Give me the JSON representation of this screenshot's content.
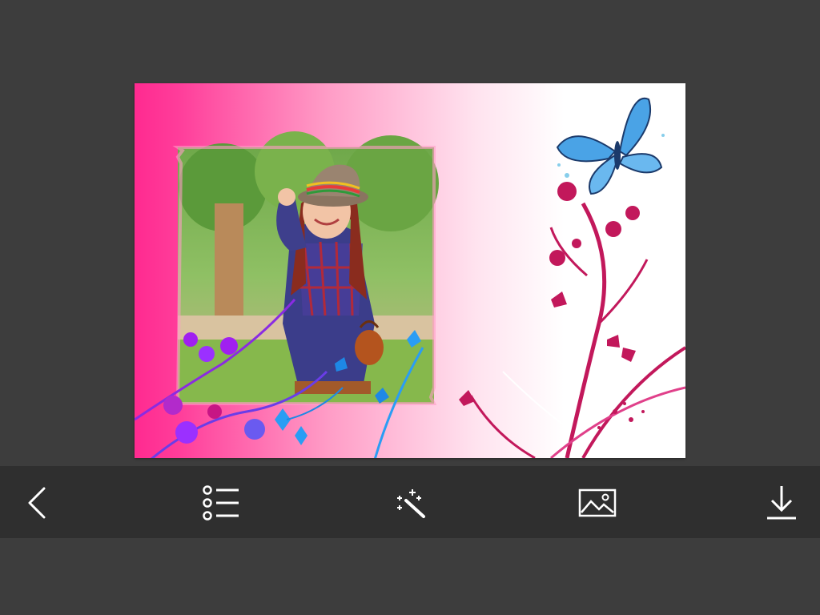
{
  "colors": {
    "background": "#3d3d3d",
    "toolbar": "#2f2f2f",
    "icon": "#ffffff",
    "frame_pink": "#ff2f93",
    "frame_light": "#ffd3e6",
    "vine_magenta": "#c2185b",
    "butterfly_blue": "#4aa3e6",
    "flower_purple": "#a020f0"
  },
  "toolbar": {
    "items": [
      {
        "id": "back",
        "icon": "chevron-left-icon"
      },
      {
        "id": "frames",
        "icon": "list-icon"
      },
      {
        "id": "effects",
        "icon": "magic-wand-icon"
      },
      {
        "id": "gallery",
        "icon": "image-icon"
      },
      {
        "id": "download",
        "icon": "download-icon"
      }
    ]
  }
}
